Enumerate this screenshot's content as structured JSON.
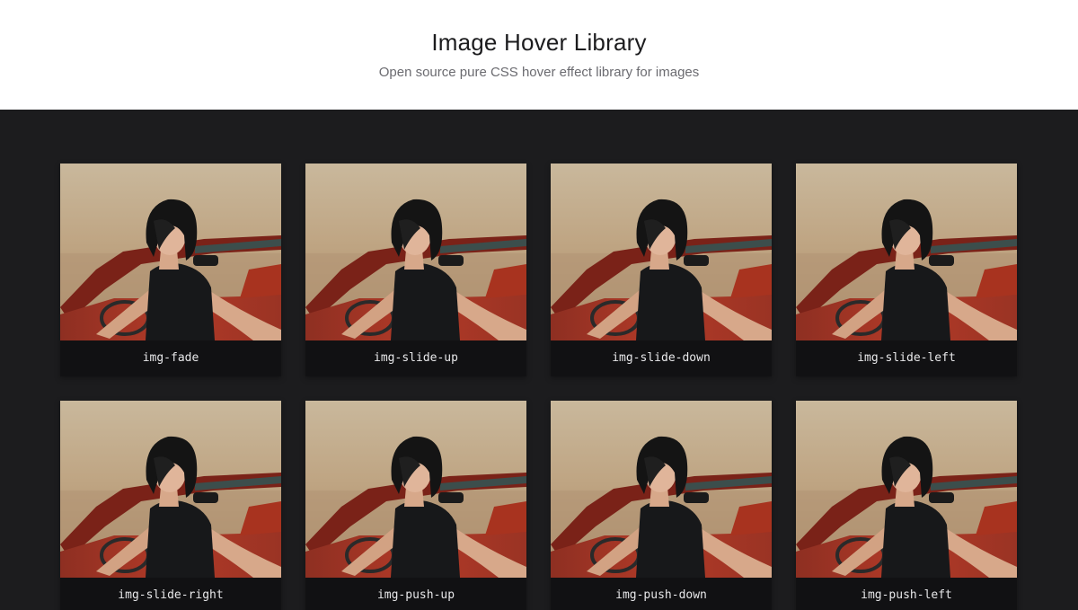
{
  "header": {
    "title": "Image Hover Library",
    "subtitle": "Open source pure CSS hover effect library for images"
  },
  "colors": {
    "page_bg": "#ffffff",
    "gallery_bg": "#1c1c1e",
    "caption_bg": "#111113",
    "caption_text": "#e8e8ea"
  },
  "cards": [
    {
      "label": "img-fade",
      "image": "portrait-photo-woman-in-red-car"
    },
    {
      "label": "img-slide-up",
      "image": "portrait-photo-woman-in-red-car"
    },
    {
      "label": "img-slide-down",
      "image": "portrait-photo-woman-in-red-car"
    },
    {
      "label": "img-slide-left",
      "image": "portrait-photo-woman-in-red-car"
    },
    {
      "label": "img-slide-right",
      "image": "portrait-photo-woman-in-red-car"
    },
    {
      "label": "img-push-up",
      "image": "portrait-photo-woman-in-red-car"
    },
    {
      "label": "img-push-down",
      "image": "portrait-photo-woman-in-red-car"
    },
    {
      "label": "img-push-left",
      "image": "portrait-photo-woman-in-red-car"
    }
  ]
}
